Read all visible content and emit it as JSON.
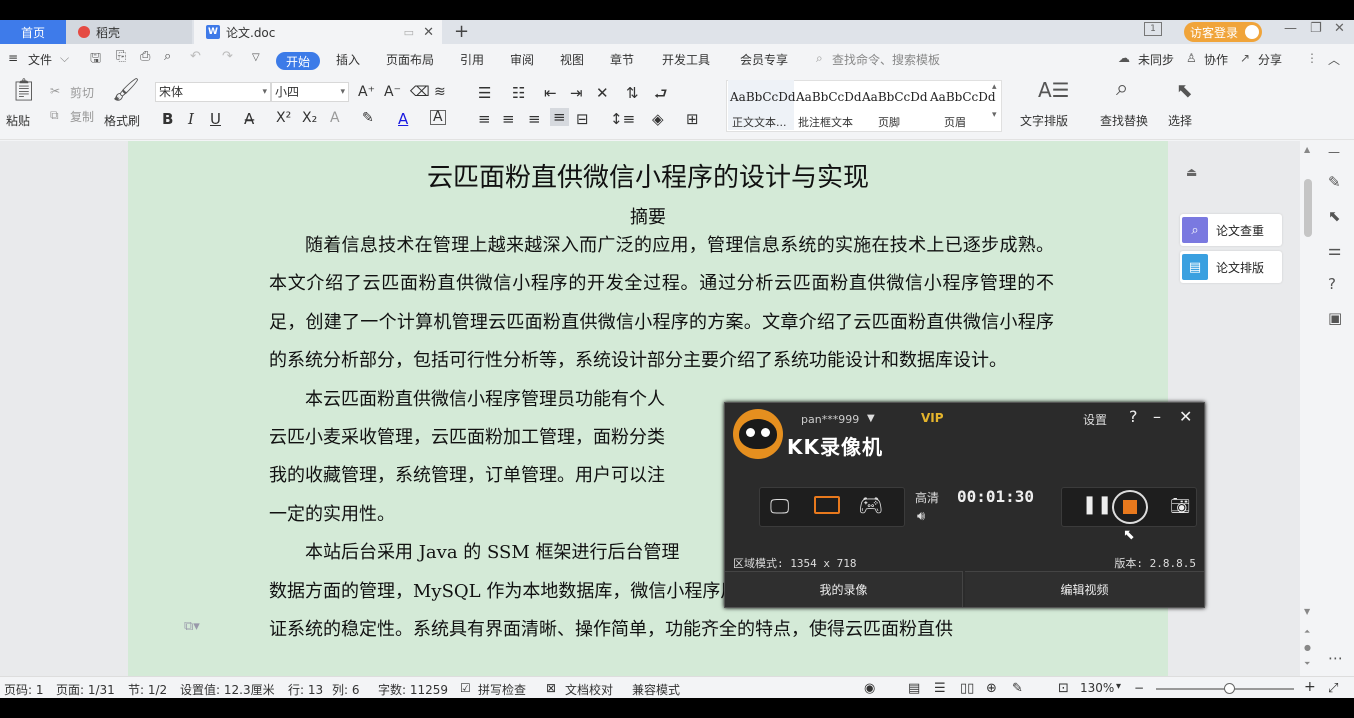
{
  "titlebar": {
    "home_tab": "首页",
    "tabs": [
      {
        "label": "稻壳"
      },
      {
        "label": "论文.doc"
      }
    ],
    "login_label": "访客登录"
  },
  "menu": {
    "file": "文件",
    "start": "开始",
    "items": [
      "插入",
      "页面布局",
      "引用",
      "审阅",
      "视图",
      "章节",
      "开发工具",
      "会员专享"
    ],
    "search_placeholder": "查找命令、搜索模板",
    "sync": "未同步",
    "collab": "协作",
    "share": "分享"
  },
  "ribbon": {
    "paste": "粘贴",
    "cut": "剪切",
    "copy": "复制",
    "format_painter": "格式刷",
    "font_name": "宋体",
    "font_size": "小四",
    "styles": [
      {
        "sample": "AaBbCcDd",
        "label": "正文文本..."
      },
      {
        "sample": "AaBbCcDd",
        "label": "批注框文本"
      },
      {
        "sample": "AaBbCcDd",
        "label": "页脚"
      },
      {
        "sample": "AaBbCcDd",
        "label": "页眉"
      }
    ],
    "text_layout": "文字排版",
    "find_replace": "查找替换",
    "select": "选择"
  },
  "document": {
    "title": "云匹面粉直供微信小程序的设计与实现",
    "abstract_heading": "摘要",
    "paragraphs": [
      "随着信息技术在管理上越来越深入而广泛的应用，管理信息系统的实施在技术上已逐步成熟。本文介绍了云匹面粉直供微信小程序的开发全过程。通过分析云匹面粉直供微信小程序管理的不足，创建了一个计算机管理云匹面粉直供微信小程序的方案。文章介绍了云匹面粉直供微信小程序的系统分析部分，包括可行性分析等，系统设计部分主要介绍了系统功能设计和数据库设计。",
      "本云匹面粉直供微信小程序管理员功能有个人",
      "云匹小麦采收管理，云匹面粉加工管理，面粉分类",
      "我的收藏管理，系统管理，订单管理。用户可以注",
      "一定的实用性。",
      "本站后台采用 Java 的 SSM 框架进行后台管理",
      "数据方面的管理，MySQL 作为本地数据库，微信小程序用到了微信开发者工具，充分保",
      "证系统的稳定性。系统具有界面清晰、操作简单，功能齐全的特点，使得云匹面粉直供"
    ]
  },
  "side_panel": {
    "check": "论文查重",
    "layout": "论文排版"
  },
  "statusbar": {
    "page_code": "页码: 1",
    "page": "页面: 1/31",
    "section": "节: 1/2",
    "setting": "设置值: 12.3厘米",
    "row": "行: 13",
    "col": "列: 6",
    "words": "字数: 11259",
    "spell": "拼写检查",
    "proof": "文档校对",
    "compat": "兼容模式",
    "zoom": "130%"
  },
  "recorder": {
    "username": "pan***999",
    "vip": "VIP",
    "app_name": "KK录像机",
    "settings": "设置",
    "quality": "高清",
    "timer": "00:01:30",
    "region_mode": "区域模式: 1354 x 718",
    "version": "版本: 2.8.8.5",
    "my_recordings": "我的录像",
    "edit_video": "编辑视频",
    "accent": "#e8791d"
  }
}
